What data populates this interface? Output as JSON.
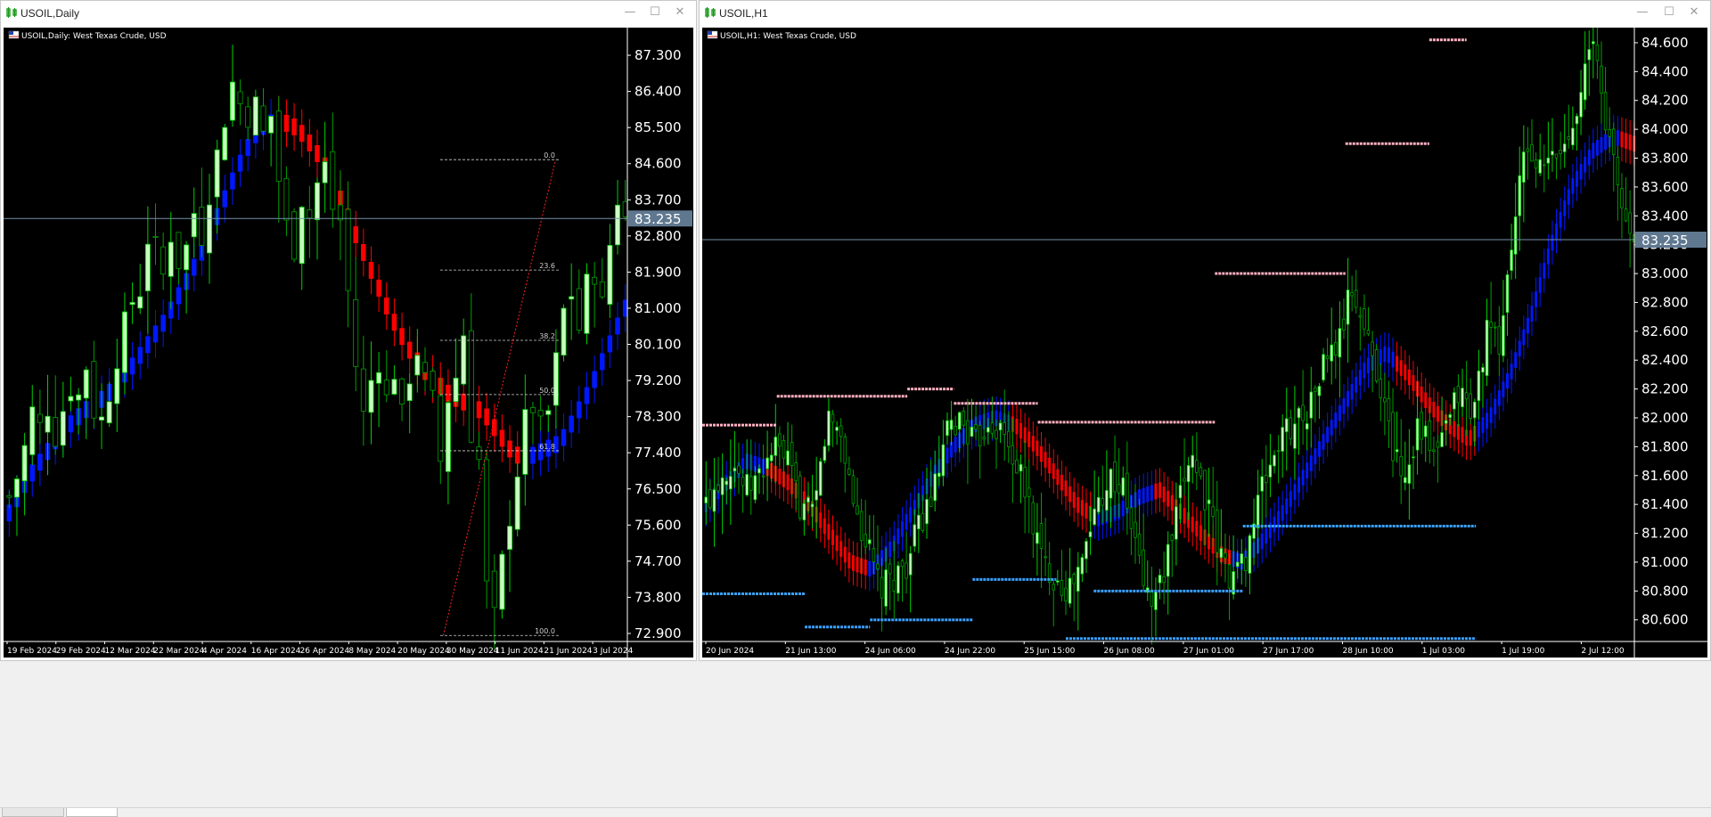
{
  "windows": {
    "left": {
      "title": "USOIL,Daily",
      "header": "USOIL,Daily:  West Texas Crude, USD",
      "price_label": "83.235"
    },
    "right": {
      "title": "USOIL,H1",
      "header": "USOIL,H1:  West Texas Crude, USD",
      "price_label": "83.235"
    }
  },
  "window_buttons": {
    "minimize": "—",
    "maximize": "☐",
    "close": "✕"
  },
  "colors": {
    "background": "#000000",
    "bull": "#00d000",
    "bull_body": "#c8ffc0",
    "bear": "#00a000",
    "band_up": "#0018ff",
    "band_down": "#ff0000",
    "resistance": "#ffb0c0",
    "support": "#3aa0ff",
    "axis_text": "#ffffff",
    "grid": "#000000"
  },
  "chart_data": [
    {
      "type": "candlestick",
      "title": "USOIL,Daily:  West Texas Crude, USD",
      "y_ticks": [
        "87.300",
        "86.400",
        "85.500",
        "84.600",
        "83.700",
        "82.800",
        "81.900",
        "81.000",
        "80.100",
        "79.200",
        "78.300",
        "77.400",
        "76.500",
        "75.600",
        "74.700",
        "73.800",
        "72.900"
      ],
      "ylim": [
        72.7,
        87.9
      ],
      "x_ticks": [
        "19 Feb 2024",
        "29 Feb 2024",
        "12 Mar 2024",
        "22 Mar 2024",
        "4 Apr 2024",
        "16 Apr 2024",
        "26 Apr 2024",
        "8 May 2024",
        "20 May 2024",
        "30 May 2024",
        "11 Jun 2024",
        "21 Jun 2024",
        "3 Jul 2024"
      ],
      "current_price": 83.235,
      "fibonacci": {
        "levels": [
          "0.0",
          "23.6",
          "38.2",
          "50.0",
          "61.8",
          "100.0"
        ],
        "values": [
          84.7,
          81.95,
          80.2,
          78.85,
          77.45,
          72.85
        ]
      },
      "close_path": [
        76.3,
        76.8,
        77.5,
        78.4,
        78.0,
        78.6,
        77.9,
        78.5,
        79.1,
        78.8,
        79.6,
        78.5,
        78.2,
        79.0,
        79.9,
        80.5,
        81.2,
        81.5,
        82.8,
        82.4,
        81.8,
        82.9,
        82.2,
        82.5,
        83.4,
        82.9,
        84.0,
        84.8,
        85.8,
        86.6,
        86.1,
        85.9,
        86.0,
        85.3,
        85.8,
        84.2,
        83.0,
        82.6,
        83.8,
        83.3,
        84.1,
        84.5,
        83.5,
        83.2,
        81.4,
        79.6,
        78.3,
        79.2,
        79.8,
        78.7,
        79.5,
        78.2,
        79.4,
        80.0,
        79.1,
        78.6,
        77.2,
        78.8,
        79.3,
        80.4,
        78.0,
        77.2,
        74.0,
        73.2,
        74.6,
        75.9,
        77.0,
        78.1,
        78.6,
        77.9,
        78.4,
        79.6,
        80.9,
        81.4,
        80.5,
        81.5,
        82.0,
        81.0,
        82.6,
        83.8,
        83.2
      ],
      "band_mid": [
        75.9,
        76.3,
        76.7,
        77.0,
        77.3,
        77.6,
        77.9,
        78.1,
        78.3,
        78.5,
        78.6,
        78.8,
        79.0,
        79.3,
        79.5,
        79.8,
        80.1,
        80.4,
        80.7,
        81.1,
        81.5,
        81.9,
        82.3,
        82.8,
        83.3,
        83.8,
        84.3,
        84.8,
        85.2,
        85.5,
        85.6,
        85.7,
        85.6,
        85.5,
        85.3,
        85.0,
        84.7,
        84.3,
        83.8,
        83.3,
        82.8,
        82.3,
        81.8,
        81.3,
        80.8,
        80.4,
        80.0,
        79.7,
        79.4,
        79.2,
        79.0,
        78.8,
        78.7,
        78.6,
        78.5,
        78.3,
        78.0,
        77.7,
        77.4,
        77.3,
        77.3,
        77.4,
        77.5,
        77.6,
        77.8,
        78.2,
        78.6,
        79.0,
        79.5,
        80.0,
        80.5,
        81.0
      ],
      "band_trend": [
        "up",
        "up",
        "up",
        "up",
        "up",
        "up",
        "up",
        "up",
        "up",
        "up",
        "up",
        "up",
        "up",
        "up",
        "up",
        "up",
        "up",
        "up",
        "up",
        "up",
        "up",
        "up",
        "up",
        "up",
        "up",
        "up",
        "up",
        "up",
        "up",
        "up",
        "up",
        "down",
        "down",
        "down",
        "down",
        "down",
        "down",
        "down",
        "down",
        "down",
        "down",
        "down",
        "down",
        "down",
        "down",
        "down",
        "down",
        "down",
        "down",
        "down",
        "down",
        "down",
        "down",
        "down",
        "down",
        "down",
        "down",
        "down",
        "down",
        "up",
        "up",
        "up",
        "up",
        "up",
        "up",
        "up",
        "up",
        "up",
        "up",
        "up",
        "up",
        "up"
      ]
    },
    {
      "type": "candlestick",
      "title": "USOIL,H1:  West Texas Crude, USD",
      "y_ticks": [
        "84.600",
        "84.400",
        "84.200",
        "84.000",
        "83.800",
        "83.600",
        "83.400",
        "83.200",
        "83.000",
        "82.800",
        "82.600",
        "82.400",
        "82.200",
        "82.000",
        "81.800",
        "81.600",
        "81.400",
        "81.200",
        "81.000",
        "80.800",
        "80.600"
      ],
      "ylim": [
        80.45,
        84.68
      ],
      "x_ticks": [
        "20 Jun 2024",
        "21 Jun 13:00",
        "24 Jun 06:00",
        "24 Jun 22:00",
        "25 Jun 15:00",
        "26 Jun 08:00",
        "27 Jun 01:00",
        "27 Jun 17:00",
        "28 Jun 10:00",
        "1 Jul 03:00",
        "1 Jul 19:00",
        "2 Jul 12:00"
      ],
      "current_price": 83.235,
      "close_path": [
        81.4,
        81.6,
        81.7,
        81.5,
        81.6,
        81.8,
        81.7,
        81.4,
        81.3,
        82.0,
        81.9,
        81.4,
        81.1,
        80.8,
        80.9,
        81.0,
        81.3,
        81.5,
        81.9,
        82.0,
        81.8,
        82.0,
        81.9,
        81.7,
        81.4,
        81.0,
        80.9,
        80.8,
        81.0,
        81.4,
        81.6,
        81.5,
        81.1,
        80.7,
        80.9,
        81.3,
        81.8,
        81.5,
        81.1,
        80.9,
        81.0,
        81.4,
        81.7,
        81.9,
        82.0,
        82.1,
        82.4,
        82.5,
        82.9,
        82.6,
        82.3,
        81.8,
        81.6,
        82.0,
        81.7,
        81.9,
        82.2,
        82.0,
        82.6,
        82.5,
        83.3,
        83.9,
        83.7,
        83.8,
        83.9,
        84.3,
        84.6,
        84.0,
        83.5,
        83.2
      ],
      "band_mid": [
        81.4,
        81.55,
        81.7,
        81.65,
        81.55,
        81.4,
        81.2,
        81.0,
        80.95,
        81.1,
        81.35,
        81.6,
        81.8,
        81.95,
        82.0,
        81.95,
        81.8,
        81.6,
        81.4,
        81.3,
        81.35,
        81.45,
        81.5,
        81.35,
        81.2,
        81.05,
        81.0,
        81.15,
        81.35,
        81.6,
        81.85,
        82.1,
        82.35,
        82.45,
        82.3,
        82.1,
        81.95,
        81.85,
        82.0,
        82.3,
        82.7,
        83.2,
        83.6,
        83.85,
        83.95,
        83.9
      ],
      "band_trend": [
        "up",
        "up",
        "up",
        "down",
        "down",
        "down",
        "down",
        "down",
        "up",
        "up",
        "up",
        "up",
        "up",
        "up",
        "up",
        "down",
        "down",
        "down",
        "down",
        "up",
        "up",
        "up",
        "down",
        "down",
        "down",
        "down",
        "up",
        "up",
        "up",
        "up",
        "up",
        "up",
        "up",
        "up",
        "down",
        "down",
        "down",
        "down",
        "up",
        "up",
        "up",
        "up",
        "up",
        "up",
        "up",
        "down"
      ],
      "resistance_levels": [
        {
          "price": 81.95,
          "from": 0.0,
          "to": 0.08
        },
        {
          "price": 82.15,
          "from": 0.08,
          "to": 0.22
        },
        {
          "price": 82.2,
          "from": 0.22,
          "to": 0.27
        },
        {
          "price": 82.1,
          "from": 0.27,
          "to": 0.36
        },
        {
          "price": 81.97,
          "from": 0.36,
          "to": 0.55
        },
        {
          "price": 83.0,
          "from": 0.55,
          "to": 0.69
        },
        {
          "price": 83.9,
          "from": 0.69,
          "to": 0.78
        },
        {
          "price": 84.62,
          "from": 0.78,
          "to": 0.82
        }
      ],
      "support_levels": [
        {
          "price": 80.78,
          "from": 0.0,
          "to": 0.11
        },
        {
          "price": 80.55,
          "from": 0.11,
          "to": 0.18
        },
        {
          "price": 80.6,
          "from": 0.18,
          "to": 0.29
        },
        {
          "price": 80.88,
          "from": 0.29,
          "to": 0.38
        },
        {
          "price": 80.8,
          "from": 0.42,
          "to": 0.58
        },
        {
          "price": 81.25,
          "from": 0.58,
          "to": 0.83
        },
        {
          "price": 80.47,
          "from": 0.39,
          "to": 0.83
        }
      ]
    }
  ]
}
